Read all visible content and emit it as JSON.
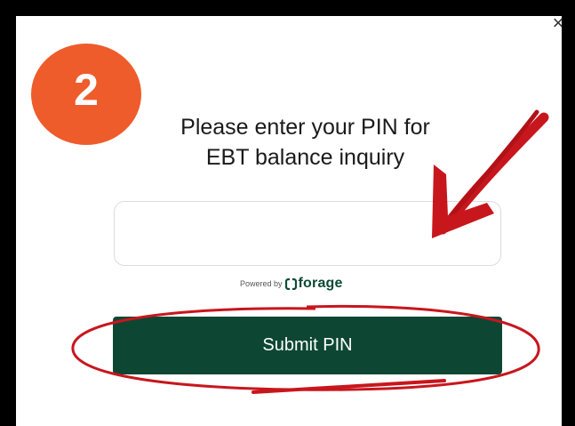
{
  "dialog": {
    "step_number": "2",
    "close_label": "×",
    "title_line1": "Please enter your PIN for",
    "title_line2": "EBT balance inquiry",
    "pin_input": {
      "value": "",
      "placeholder": ""
    },
    "powered_by": {
      "prefix": "Powered by",
      "brand": "forage",
      "icon": "forage-logo-icon"
    },
    "submit_label": "Submit PIN"
  },
  "colors": {
    "badge": "#ee5c2b",
    "submit_background": "#0d4733",
    "annotation_red": "#c8161d",
    "brand_green": "#0b4a36"
  },
  "annotations": {
    "arrow_icon": "red-arrow-icon",
    "circle_icon": "red-ellipse-highlight-icon"
  }
}
